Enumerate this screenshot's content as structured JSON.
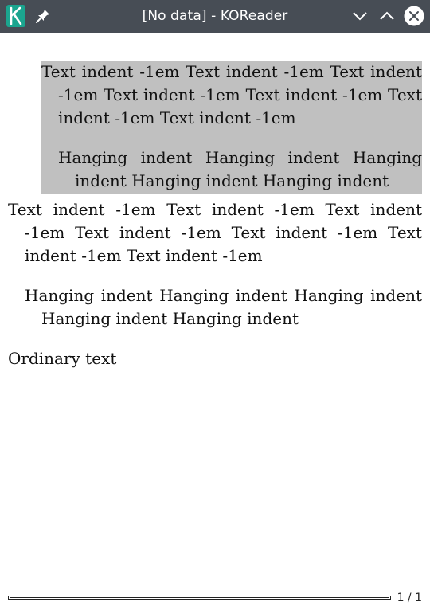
{
  "window": {
    "title": "[No data] - KOReader",
    "app_icon": "koreader-k-icon",
    "pin_icon": "pin-icon",
    "minimize_icon": "chevron-down-icon",
    "maximize_icon": "chevron-up-icon",
    "close_icon": "close-icon"
  },
  "document": {
    "shaded_block": {
      "text_indent_para": "Text indent -1em Text indent -1em Text indent -1em Text indent -1em Text indent -1em Text indent -1em Text indent -1em",
      "hanging_para": "Hanging indent Hanging indent Hanging indent Hanging indent Hanging indent"
    },
    "text_indent_para": "Text indent -1em Text indent -1em Text indent -1em Text indent -1em Text indent -1em Text indent -1em Text indent -1em",
    "hanging_para": "Hanging indent Hanging indent Hanging indent Hanging indent Hanging indent",
    "ordinary_para": "Ordinary text",
    "shade_color": "#c0c0c0"
  },
  "footer": {
    "progress_fraction": 1.0,
    "page_counter": "1 / 1"
  }
}
